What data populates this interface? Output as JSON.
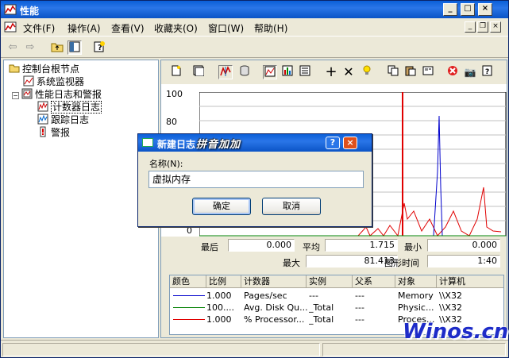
{
  "window": {
    "title": "性能"
  },
  "menu": [
    "文件(F)",
    "操作(A)",
    "查看(V)",
    "收藏夹(O)",
    "窗口(W)",
    "帮助(H)"
  ],
  "title_buttons": {
    "minimize": "_",
    "maximize": "□",
    "close": "×"
  },
  "tree": {
    "root": "控制台根节点",
    "items": [
      "系统监视器",
      "性能日志和警报",
      "计数器日志",
      "跟踪日志",
      "警报"
    ]
  },
  "chart": {
    "yticks": [
      "100",
      "80",
      "0"
    ]
  },
  "stats": {
    "last_label": "最后",
    "last_value": "0.000",
    "avg_label": "平均",
    "avg_value": "1.715",
    "min_label": "最小",
    "min_value": "0.000",
    "max_label": "最大",
    "max_value": "81.413",
    "time_label": "图形时间",
    "time_value": "1:40"
  },
  "legend": {
    "headers": [
      "颜色",
      "比例",
      "计数器",
      "实例",
      "父系",
      "对象",
      "计算机"
    ],
    "rows": [
      {
        "color": "#0000CC",
        "scale": "1.000",
        "counter": "Pages/sec",
        "instance": "---",
        "parent": "---",
        "object": "Memory",
        "computer": "\\\\X32"
      },
      {
        "color": "#008000",
        "scale": "100....",
        "counter": "Avg. Disk Qu...",
        "instance": "_Total",
        "parent": "---",
        "object": "Physic...",
        "computer": "\\\\X32"
      },
      {
        "color": "#E00000",
        "scale": "1.000",
        "counter": "% Processor...",
        "instance": "_Total",
        "parent": "---",
        "object": "Proces...",
        "computer": "\\\\X32"
      }
    ]
  },
  "dialog": {
    "title": "新建日志",
    "help": "?",
    "close": "×",
    "name_label": "名称(N):",
    "name_value": "虚拟内存",
    "ok": "确定",
    "cancel": "取消"
  },
  "overlay_text": "拼音加加",
  "watermark": "Winos.cn",
  "colors": {
    "titlebar": "#0A5FD8",
    "graph_red": "#E00000",
    "graph_blue": "#0000CC",
    "graph_green": "#008000"
  }
}
